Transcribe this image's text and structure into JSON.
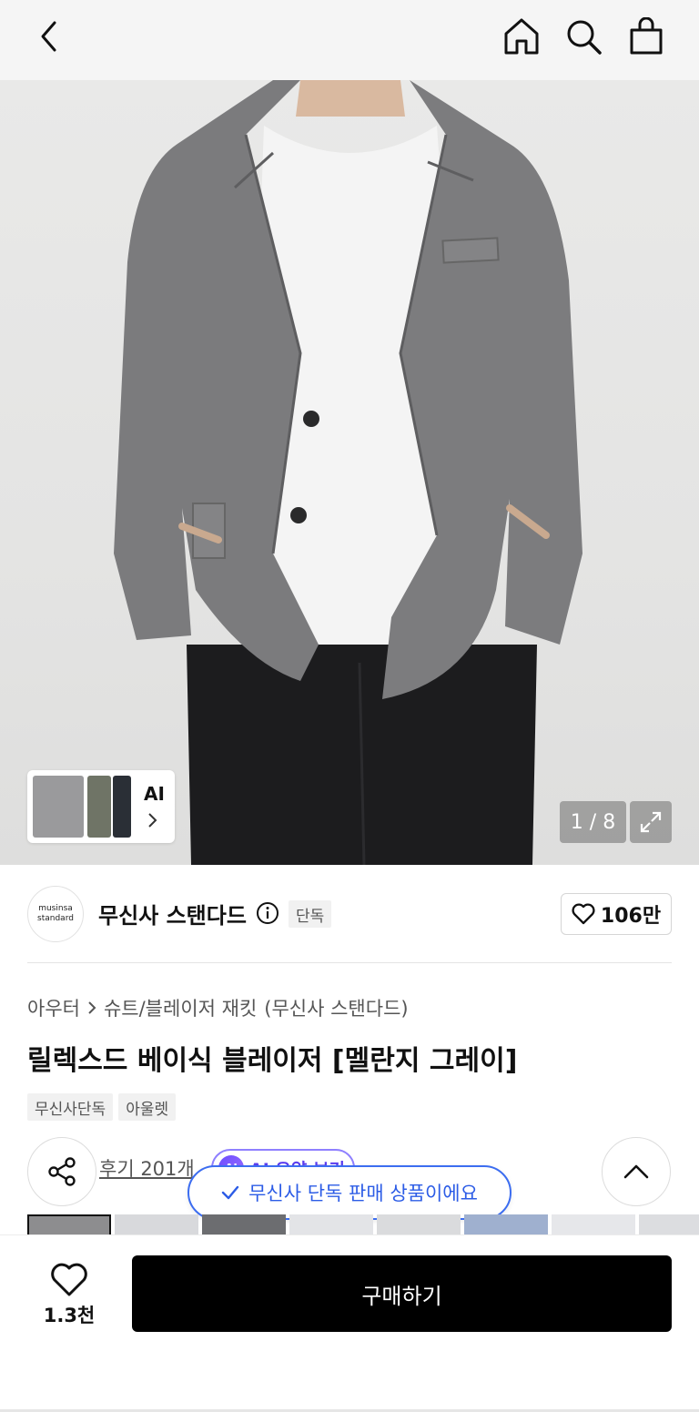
{
  "header": {
    "back_icon": "chevron-left-icon",
    "home_icon": "home-icon",
    "search_icon": "search-icon",
    "cart_icon": "shopping-bag-icon"
  },
  "gallery": {
    "ai_label": "AI",
    "counter": "1 / 8",
    "zoom_icon": "expand-icon"
  },
  "brand": {
    "logo_line1": "musinsa",
    "logo_line2": "standard",
    "name": "무신사 스탠다드",
    "exclusive_badge": "단독",
    "likes": "106만"
  },
  "product": {
    "breadcrumb": [
      "아우터",
      "슈트/블레이저 재킷",
      "(무신사 스탠다드)"
    ],
    "title": "릴렉스드 베이식 블레이저 [멜란지 그레이]",
    "tags": [
      "무신사단독",
      "아울렛"
    ]
  },
  "review": {
    "link": "후기 201개",
    "ai_summary": "AI 요약 보기",
    "ai_badge": "AI"
  },
  "toast": {
    "text": "무신사 단독 판매 상품이에요"
  },
  "bottom": {
    "wish_count": "1.3천",
    "buy_label": "구매하기"
  },
  "colors": {
    "accent_blue": "#2c5ce6",
    "ai_purple": "#6a4cff",
    "buy_bg": "#000000"
  }
}
